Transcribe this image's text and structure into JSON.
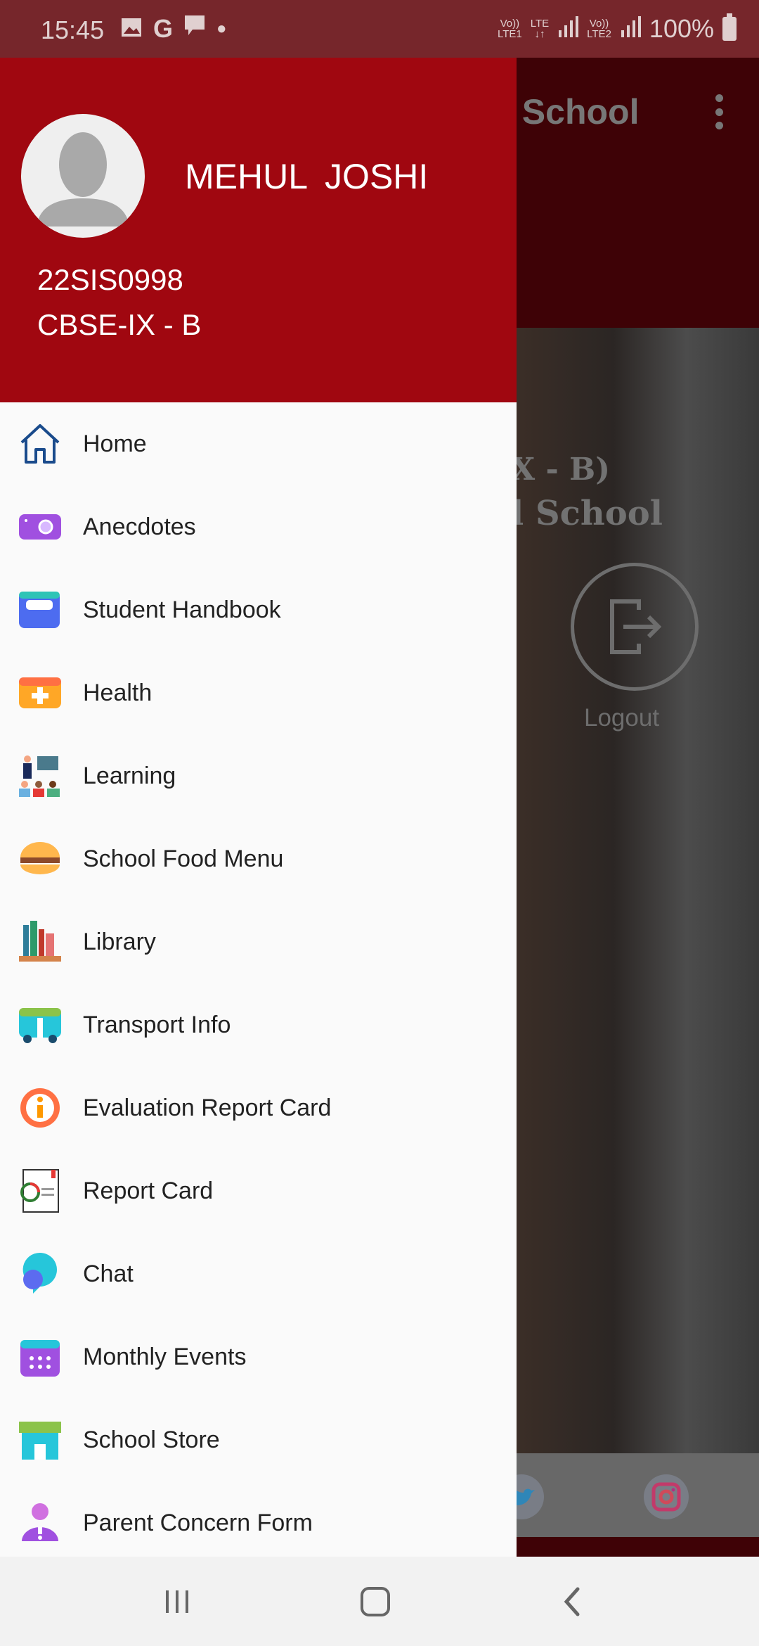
{
  "status_bar": {
    "time": "15:45",
    "battery": "100%",
    "sim1": "LTE1",
    "sim2": "LTE2",
    "network": "LTE"
  },
  "background": {
    "toolbar_title": "l School",
    "hero_line1": "X - B)",
    "hero_line2": "l School",
    "logout_label": "Logout",
    "social": [
      "twitter-icon",
      "instagram-icon"
    ]
  },
  "drawer": {
    "user_name": "MEHUL  JOSHI",
    "student_id": "22SIS0998",
    "class": "CBSE-IX - B",
    "header_color": "#a00710",
    "items": [
      {
        "label": "Home",
        "icon": "home-icon"
      },
      {
        "label": "Anecdotes",
        "icon": "camera-icon"
      },
      {
        "label": "Student Handbook",
        "icon": "handbook-icon"
      },
      {
        "label": "Health",
        "icon": "health-icon"
      },
      {
        "label": "Learning",
        "icon": "learning-icon"
      },
      {
        "label": "School Food Menu",
        "icon": "burger-icon"
      },
      {
        "label": "Library",
        "icon": "books-icon"
      },
      {
        "label": "Transport Info",
        "icon": "bus-icon"
      },
      {
        "label": "Evaluation Report Card",
        "icon": "info-icon"
      },
      {
        "label": "Report Card",
        "icon": "report-icon"
      },
      {
        "label": "Chat",
        "icon": "chat-icon"
      },
      {
        "label": "Monthly Events",
        "icon": "calendar-icon"
      },
      {
        "label": "School Store",
        "icon": "store-icon"
      },
      {
        "label": "Parent Concern Form",
        "icon": "parent-icon"
      }
    ]
  },
  "nav_bar": [
    "recents-button",
    "home-button",
    "back-button"
  ]
}
